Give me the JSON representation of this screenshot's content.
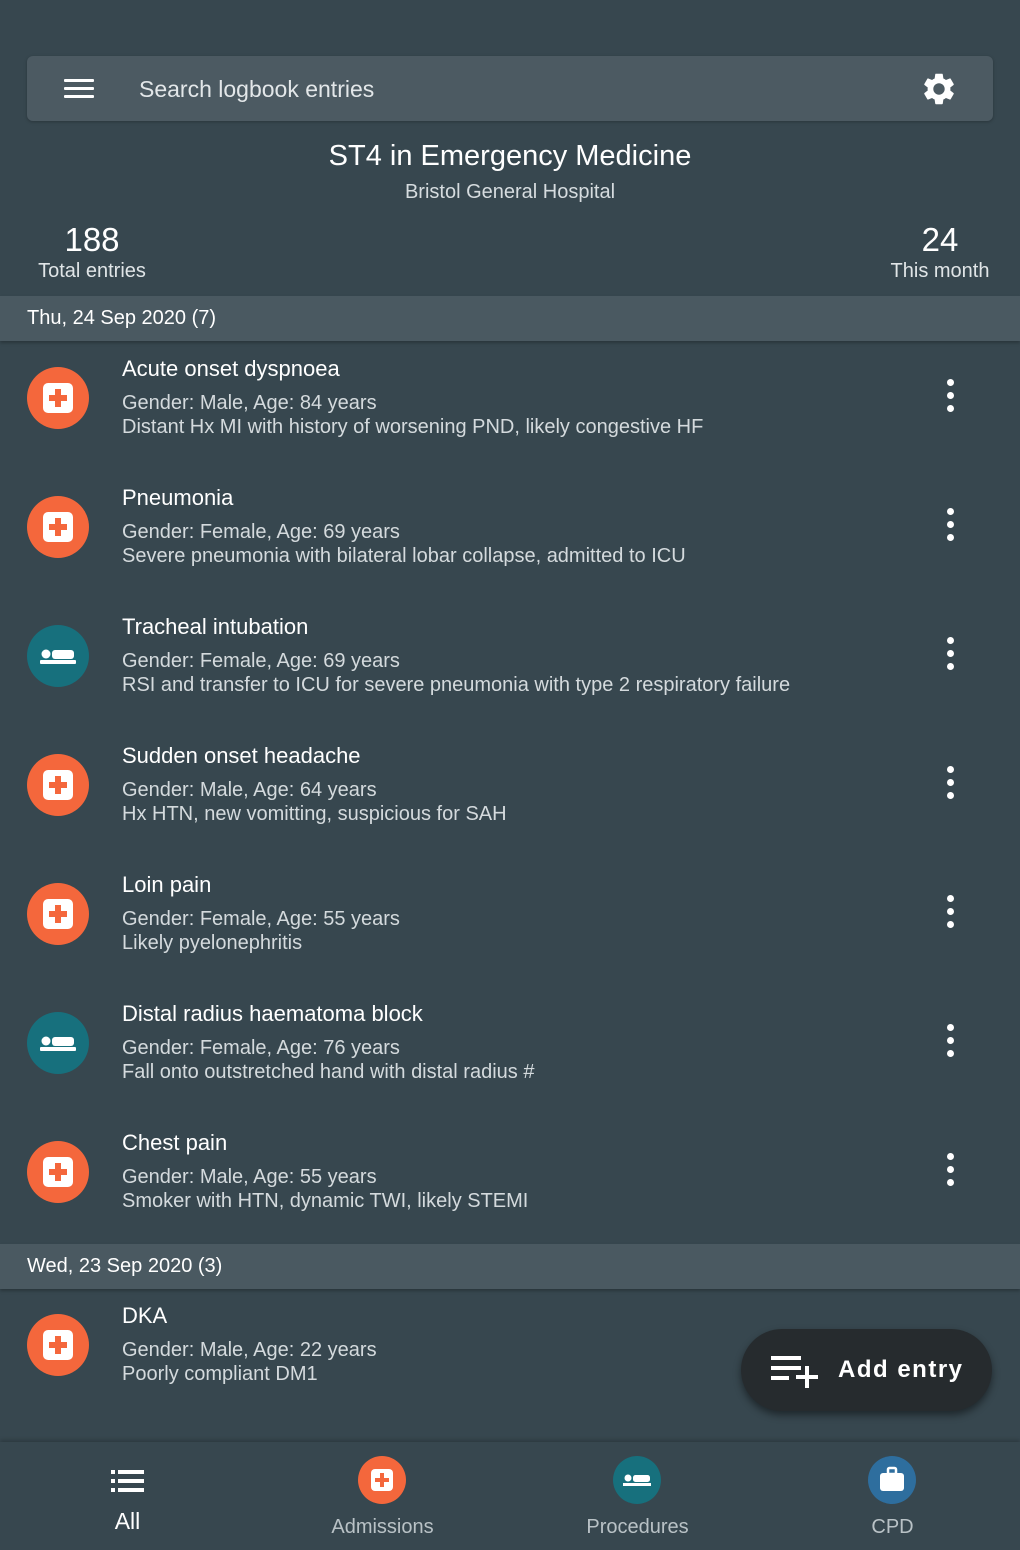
{
  "search": {
    "placeholder": "Search logbook entries",
    "menu_icon": "menu-icon",
    "settings_icon": "gear-icon"
  },
  "header": {
    "title": "ST4 in Emergency Medicine",
    "subtitle": "Bristol General Hospital",
    "total_entries": "188",
    "total_entries_label": "Total entries",
    "this_month": "24",
    "this_month_label": "This month"
  },
  "groups": [
    {
      "date": "Thu, 24 Sep 2020 (7)",
      "entries": [
        {
          "type": "admission",
          "title": "Acute onset dyspnoea",
          "line1": "Gender: Male, Age: 84 years",
          "line2": "Distant Hx MI with history of worsening PND, likely congestive HF"
        },
        {
          "type": "admission",
          "title": "Pneumonia",
          "line1": "Gender: Female, Age: 69 years",
          "line2": "Severe pneumonia with bilateral lobar collapse, admitted to ICU"
        },
        {
          "type": "procedure",
          "title": "Tracheal intubation",
          "line1": "Gender: Female, Age: 69 years",
          "line2": "RSI and transfer to ICU for severe pneumonia with type 2 respiratory failure"
        },
        {
          "type": "admission",
          "title": "Sudden onset headache",
          "line1": "Gender: Male, Age: 64 years",
          "line2": "Hx HTN, new vomitting, suspicious for SAH"
        },
        {
          "type": "admission",
          "title": "Loin pain",
          "line1": "Gender: Female, Age: 55 years",
          "line2": "Likely pyelonephritis"
        },
        {
          "type": "procedure",
          "title": "Distal radius haematoma block",
          "line1": "Gender: Female, Age: 76 years",
          "line2": "Fall onto outstretched hand with distal radius #"
        },
        {
          "type": "admission",
          "title": "Chest pain",
          "line1": "Gender: Male, Age: 55 years",
          "line2": "Smoker with HTN, dynamic TWI,  likely STEMI"
        }
      ]
    },
    {
      "date": "Wed, 23 Sep 2020 (3)",
      "entries": [
        {
          "type": "admission",
          "title": "DKA",
          "line1": "Gender: Male, Age: 22 years",
          "line2": "Poorly compliant DM1"
        }
      ]
    }
  ],
  "fab": {
    "label": "Add entry",
    "icon": "playlist-add-icon"
  },
  "nav": [
    {
      "label": "All",
      "icon": "list-icon",
      "active": true
    },
    {
      "label": "Admissions",
      "icon": "admission-icon",
      "color": "#f4673c"
    },
    {
      "label": "Procedures",
      "icon": "bed-icon",
      "color": "#17707d"
    },
    {
      "label": "CPD",
      "icon": "briefcase-icon",
      "color": "#2e6e9e"
    }
  ],
  "colors": {
    "background": "#37474f",
    "date_header": "#4a5961",
    "admission": "#f4673c",
    "procedure": "#17707d",
    "cpd": "#2e6e9e",
    "fab": "#262b2e"
  }
}
